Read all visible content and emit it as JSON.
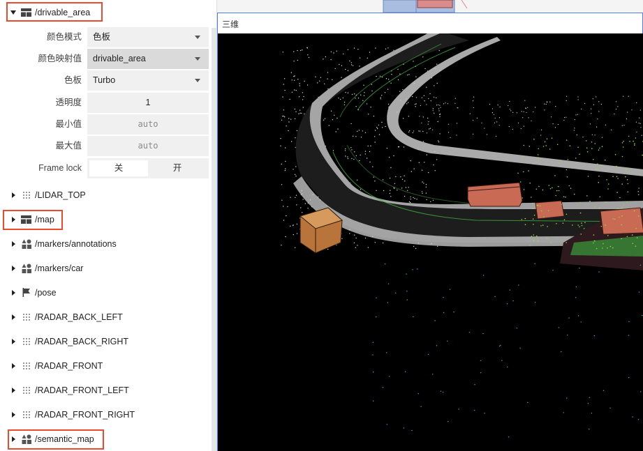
{
  "viewport": {
    "title": "三维"
  },
  "drivable_area": {
    "topic": "/drivable_area",
    "settings": {
      "color_mode": {
        "label": "颜色模式",
        "value": "色板"
      },
      "color_by": {
        "label": "颜色映射值",
        "value": "drivable_area"
      },
      "palette": {
        "label": "色板",
        "value": "Turbo"
      },
      "opacity": {
        "label": "透明度",
        "value": "1"
      },
      "min_value": {
        "label": "最小值",
        "placeholder": "auto"
      },
      "max_value": {
        "label": "最大值",
        "placeholder": "auto"
      },
      "frame_lock": {
        "label": "Frame lock",
        "off": "关",
        "on": "开",
        "selected": "关"
      }
    }
  },
  "topics": [
    {
      "label": "/LIDAR_TOP",
      "icon": "points-icon"
    },
    {
      "label": "/map",
      "icon": "grid-icon"
    },
    {
      "label": "/markers/annotations",
      "icon": "shapes-icon"
    },
    {
      "label": "/markers/car",
      "icon": "shapes-icon"
    },
    {
      "label": "/pose",
      "icon": "flag-icon"
    },
    {
      "label": "/RADAR_BACK_LEFT",
      "icon": "points-icon"
    },
    {
      "label": "/RADAR_BACK_RIGHT",
      "icon": "points-icon"
    },
    {
      "label": "/RADAR_FRONT",
      "icon": "points-icon"
    },
    {
      "label": "/RADAR_FRONT_LEFT",
      "icon": "points-icon"
    },
    {
      "label": "/RADAR_FRONT_RIGHT",
      "icon": "points-icon"
    },
    {
      "label": "/semantic_map",
      "icon": "shapes-icon"
    }
  ],
  "colors": {
    "highlight": "#ea4b2c",
    "selection": "#4c7ee8"
  }
}
